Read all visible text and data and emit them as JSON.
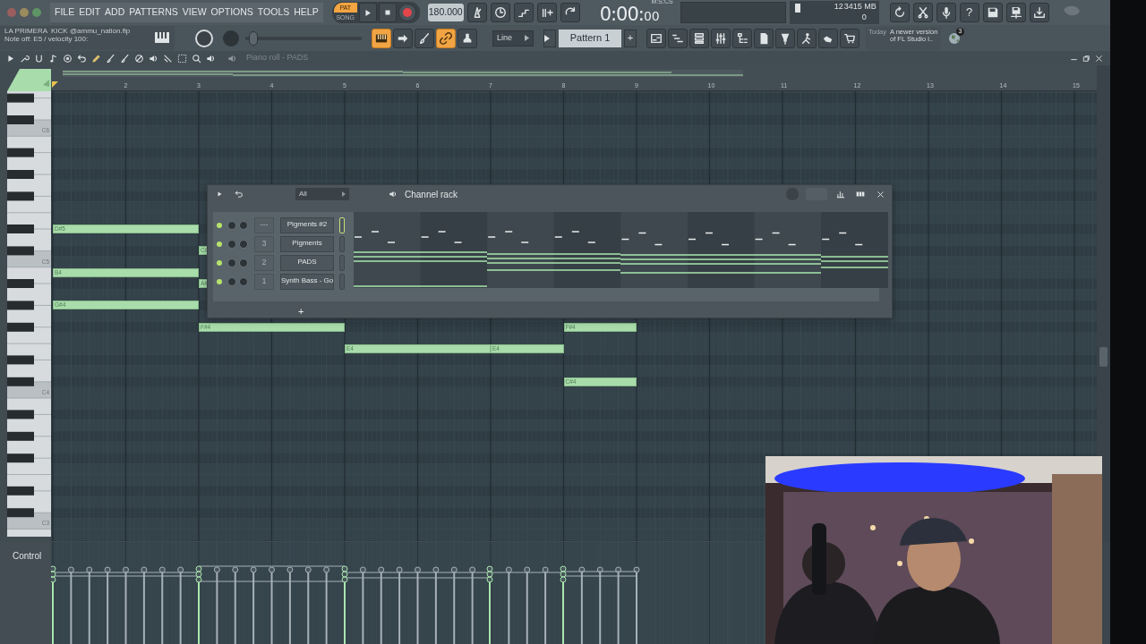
{
  "menu": [
    "FILE",
    "EDIT",
    "ADD",
    "PATTERNS",
    "VIEW",
    "OPTIONS",
    "TOOLS",
    "HELP"
  ],
  "transport": {
    "modes": [
      {
        "label": "PAT",
        "selected": true
      },
      {
        "label": "SONG",
        "selected": false
      }
    ]
  },
  "tempo": "180.000",
  "time": {
    "unit": "M:S:CS",
    "main": "0:00:",
    "fraction": "00"
  },
  "monitor": {
    "cpu": "12",
    "memory": "3415 MB",
    "polyphony": "0"
  },
  "help": "?",
  "hint": {
    "title": "LA PRIMERA  KICK @ammu_nation.flp",
    "message": "Note off: E5 / velocity 100:"
  },
  "master_slider": {
    "level": 0.03
  },
  "tools": [
    {
      "on": true
    },
    {
      "on": false
    },
    {
      "on": false
    },
    {
      "on": true
    },
    {
      "on": false
    }
  ],
  "snap": "Line",
  "pattern": "Pattern 1",
  "add_pattern": "+",
  "news": {
    "day": "Today",
    "text": "A newer version of FL Studio i..",
    "badge": "3"
  },
  "piano_roll": {
    "title": "Piano roll - PADS",
    "bars": [
      "2",
      "3",
      "4",
      "5",
      "6",
      "7",
      "8",
      "9",
      "10",
      "11",
      "12",
      "13",
      "14",
      "15"
    ],
    "octaves": [
      "C6",
      "C5",
      "C4",
      "C3"
    ],
    "notes": [
      {
        "label": "D#5"
      },
      {
        "label": "C#"
      },
      {
        "label": "B4"
      },
      {
        "label": "A#"
      },
      {
        "label": "G#4"
      },
      {
        "label": "F#4"
      },
      {
        "label": "F#4"
      },
      {
        "label": "E4"
      },
      {
        "label": "E4"
      },
      {
        "label": "C#4"
      }
    ]
  },
  "channel_rack": {
    "title": "Channel rack",
    "filter": "All",
    "add": "+",
    "channels": [
      {
        "number": "---",
        "name": "Pigments #2",
        "selected": true
      },
      {
        "number": "3",
        "name": "Pigments",
        "selected": false
      },
      {
        "number": "2",
        "name": "PADS",
        "selected": false
      },
      {
        "number": "1",
        "name": "Synth Bass - Go",
        "selected": false
      }
    ]
  },
  "control_lane": {
    "label": "Control"
  }
}
